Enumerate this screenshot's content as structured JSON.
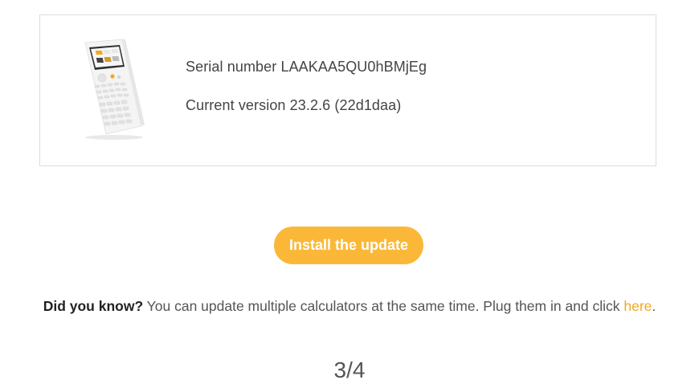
{
  "device": {
    "serial_text": "Serial number LAAKAA5QU0hBMjEg",
    "version_text": "Current version 23.2.6 (22d1daa)",
    "image": "calculator-image"
  },
  "actions": {
    "install_label": "Install the update"
  },
  "tip": {
    "label": "Did you know?",
    "text": " You can update multiple calculators at the same time. Plug them in and click ",
    "link": "here",
    "end": "."
  },
  "progress": {
    "step_text": "3/4",
    "current": 3,
    "total": 4
  },
  "colors": {
    "accent": "#fbb838",
    "link": "#f2a824",
    "border": "#dcdcdc"
  }
}
